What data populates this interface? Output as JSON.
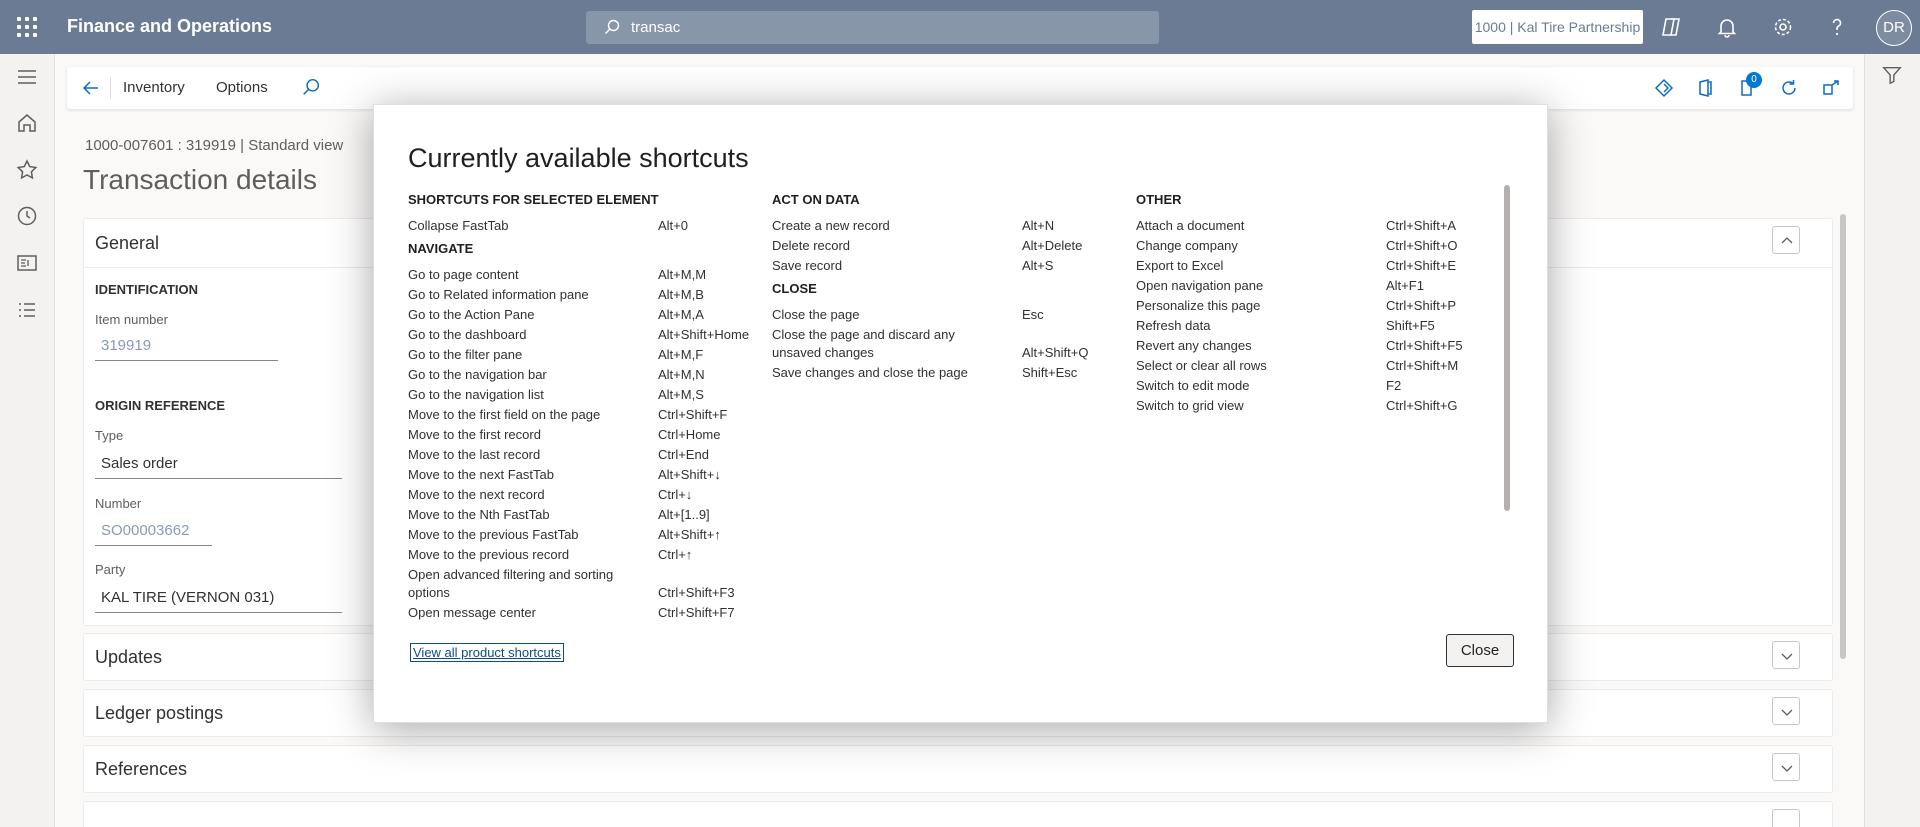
{
  "topbar": {
    "app_title": "Finance and Operations",
    "search_value": "transac",
    "company": "1000 | Kal Tire Partnership",
    "avatar_initials": "DR"
  },
  "actionbar": {
    "menu_inventory": "Inventory",
    "menu_options": "Options",
    "notification_count": "0"
  },
  "page": {
    "breadcrumb": "1000-007601 : 319919   |   Standard view ",
    "title": "Transaction details",
    "general": {
      "header": "General",
      "identification_group": "IDENTIFICATION",
      "item_number_label": "Item number",
      "item_number_value": "319919",
      "origin_group": "ORIGIN REFERENCE",
      "type_label": "Type",
      "type_value": "Sales order",
      "number_label": "Number",
      "number_value": "SO00003662",
      "party_label": "Party",
      "party_value": "KAL TIRE (VERNON 031)"
    },
    "fasttabs": [
      "Updates",
      "Ledger postings",
      "References"
    ]
  },
  "dialog": {
    "title": "Currently available shortcuts",
    "view_all": "View all product shortcuts",
    "close": "Close",
    "col1": [
      {
        "heading": "SHORTCUTS FOR SELECTED ELEMENT",
        "items": [
          {
            "name": "Collapse FastTab",
            "key": "Alt+0"
          }
        ]
      },
      {
        "heading": "NAVIGATE",
        "items": [
          {
            "name": "Go to page content",
            "key": "Alt+M,M"
          },
          {
            "name": "Go to Related information pane",
            "key": "Alt+M,B"
          },
          {
            "name": "Go to the Action Pane",
            "key": "Alt+M,A"
          },
          {
            "name": "Go to the dashboard",
            "key": "Alt+Shift+Home"
          },
          {
            "name": "Go to the filter pane",
            "key": "Alt+M,F"
          },
          {
            "name": "Go to the navigation bar",
            "key": "Alt+M,N"
          },
          {
            "name": "Go to the navigation list",
            "key": "Alt+M,S"
          },
          {
            "name": "Move to the first field on the page",
            "key": "Ctrl+Shift+F"
          },
          {
            "name": "Move to the first record",
            "key": "Ctrl+Home"
          },
          {
            "name": "Move to the last record",
            "key": "Ctrl+End"
          },
          {
            "name": "Move to the next FastTab",
            "key": "Alt+Shift+↓"
          },
          {
            "name": "Move to the next record",
            "key": "Ctrl+↓"
          },
          {
            "name": "Move to the Nth FastTab",
            "key": "Alt+[1..9]"
          },
          {
            "name": "Move to the previous FastTab",
            "key": "Alt+Shift+↑"
          },
          {
            "name": "Move to the previous record",
            "key": "Ctrl+↑"
          },
          {
            "name": "Open advanced filtering and sorting options",
            "key": "Ctrl+Shift+F3"
          },
          {
            "name": "Open message center",
            "key": "Ctrl+Shift+F7"
          }
        ]
      }
    ],
    "col2": [
      {
        "heading": "ACT ON DATA",
        "items": [
          {
            "name": "Create a new record",
            "key": "Alt+N"
          },
          {
            "name": "Delete record",
            "key": "Alt+Delete"
          },
          {
            "name": "Save record",
            "key": "Alt+S"
          }
        ]
      },
      {
        "heading": "CLOSE",
        "items": [
          {
            "name": "Close the page",
            "key": "Esc"
          },
          {
            "name": "Close the page and discard any unsaved changes",
            "key": "Alt+Shift+Q"
          },
          {
            "name": "Save changes and close the page",
            "key": "Shift+Esc"
          }
        ]
      }
    ],
    "col3": [
      {
        "heading": "OTHER",
        "items": [
          {
            "name": "Attach a document",
            "key": "Ctrl+Shift+A"
          },
          {
            "name": "Change company",
            "key": "Ctrl+Shift+O"
          },
          {
            "name": "Export to Excel",
            "key": "Ctrl+Shift+E"
          },
          {
            "name": "Open navigation pane",
            "key": "Alt+F1"
          },
          {
            "name": "Personalize this page",
            "key": "Ctrl+Shift+P"
          },
          {
            "name": "Refresh data",
            "key": "Shift+F5"
          },
          {
            "name": "Revert any changes",
            "key": "Ctrl+Shift+F5"
          },
          {
            "name": "Select or clear all rows",
            "key": "Ctrl+Shift+M"
          },
          {
            "name": "Switch to edit mode",
            "key": "F2"
          },
          {
            "name": "Switch to grid view",
            "key": "Ctrl+Shift+G"
          }
        ]
      }
    ]
  }
}
